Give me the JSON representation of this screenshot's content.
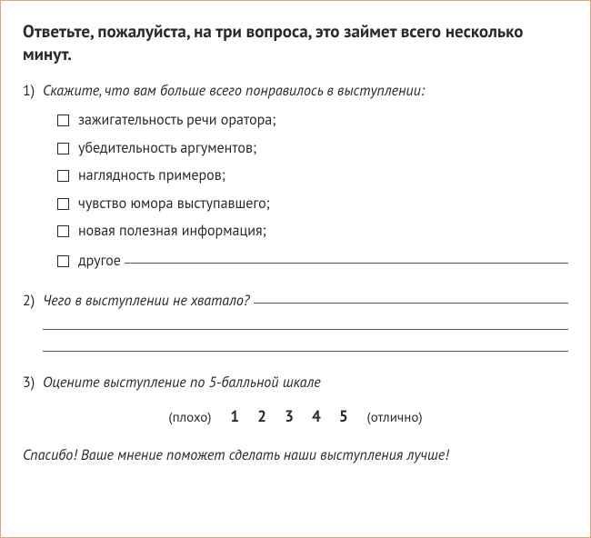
{
  "heading": "Ответьте, пожалуйста, на три вопроса, это займет всего несколько минут.",
  "q1": {
    "num": "1)",
    "text": "Скажите, что вам больше всего понравилось в выступлении:",
    "options": [
      "зажигательность речи оратора;",
      "убедительность аргументов;",
      "наглядность примеров;",
      "чувство юмора выступавшего;",
      "новая полезная информация;"
    ],
    "other_label": "другое"
  },
  "q2": {
    "num": "2)",
    "text": "Чего в выступлении не хватало?"
  },
  "q3": {
    "num": "3)",
    "text": "Оцените выступление по 5-балльной шкале",
    "low": "(плохо)",
    "high": "(отлично)",
    "scale": [
      "1",
      "2",
      "3",
      "4",
      "5"
    ]
  },
  "thanks": "Спасибо! Ваше мнение поможет сделать наши выступления лучше!"
}
